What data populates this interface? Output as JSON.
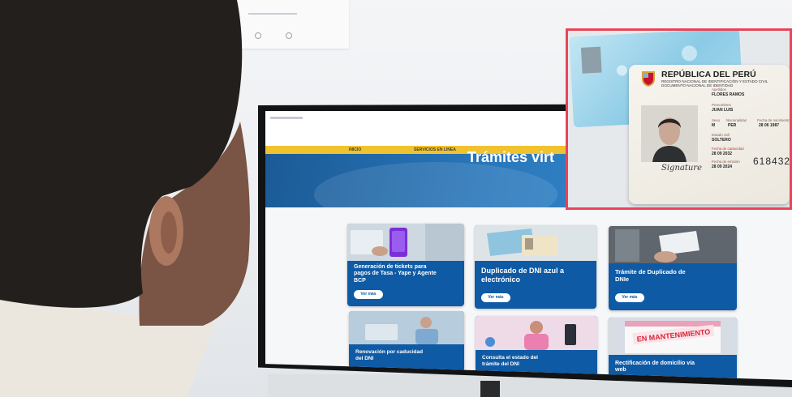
{
  "colors": {
    "wall": "#eceef1",
    "nav_yellow": "#f0c22e",
    "hero_blue": "#2a79bd",
    "card_blue": "#0e5aa5",
    "overlay_border": "#e8455a",
    "maintenance_red": "#d6273a"
  },
  "website": {
    "nav": [
      "INICIO",
      "SERVICIOS EN LINEA"
    ],
    "hero_title": "Trámites virt",
    "cards": [
      {
        "title": "Generación de tickets para pagos de Tasa - Yape y Agente BCP",
        "button": "Ver más"
      },
      {
        "title": "Duplicado de DNI azul a electrónico",
        "button": "Ver más"
      },
      {
        "title": "Trámite de Duplicado de DNIe",
        "button": "Ver más"
      },
      {
        "title": "Renovación por caducidad del DNI"
      },
      {
        "title": "Consulta el estado del trámite del DNI"
      },
      {
        "title": "Rectificación de domicilio vía web",
        "banner": "EN MANTENIMIENTO"
      }
    ]
  },
  "id_card": {
    "country": "REPÚBLICA DEL PERÚ",
    "agency": "REGISTRO NACIONAL DE IDENTIFICACIÓN Y ESTADO CIVIL",
    "document": "DOCUMENTO NACIONAL DE IDENTIDAD",
    "surname_label": "Apellidos",
    "surname": "FLORES RAMOS",
    "given_label": "Prenombres",
    "given": "JUAN LUIS",
    "sex_label": "Sexo",
    "sex": "M",
    "nationality_label": "Nacionalidad",
    "nationality": "PER",
    "birth_label": "Fecha de nacimiento",
    "birth": "28 06 1987",
    "civil_label": "Estado civil",
    "civil": "SOLTERO",
    "expiry_label": "Fecha de caducidad",
    "expiry": "28 09 2032",
    "issue_label": "Fecha de emisión",
    "issue": "28 09 2024",
    "number": "618432",
    "signature": "Signature"
  }
}
